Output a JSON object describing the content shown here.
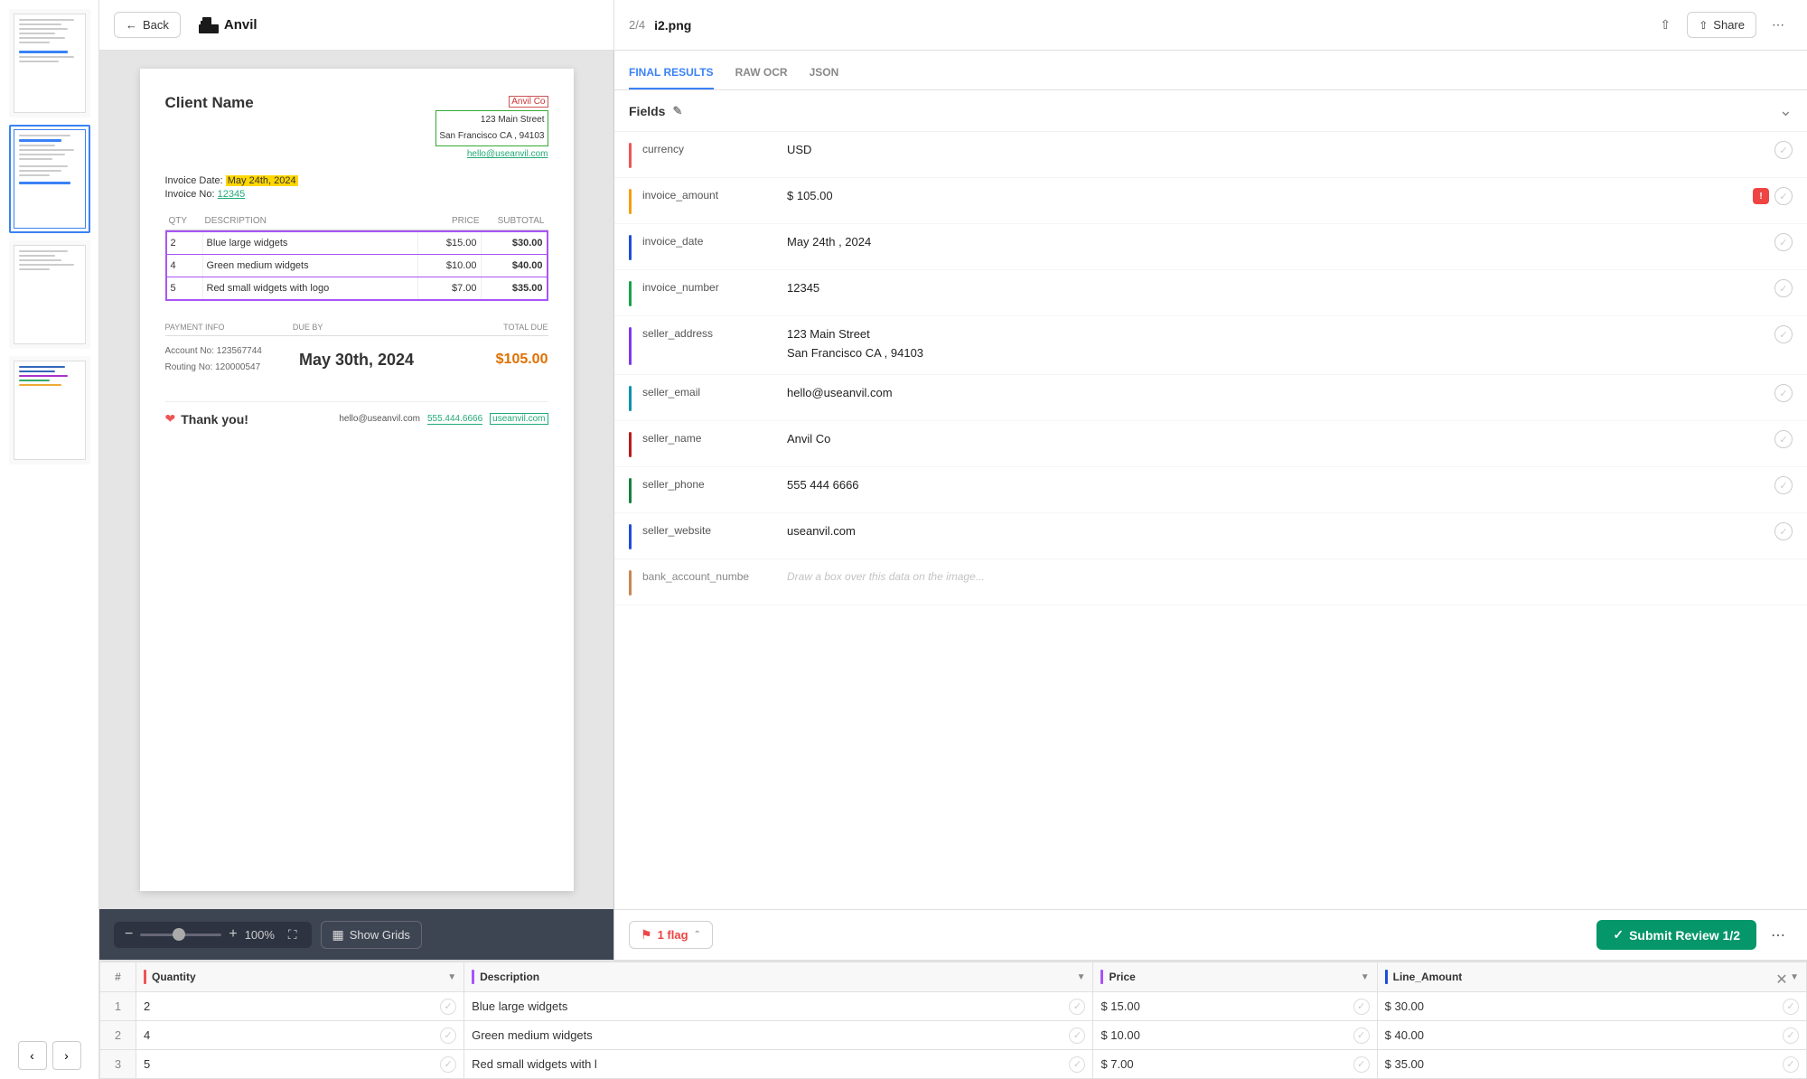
{
  "app": {
    "back_label": "Back",
    "logo_text": "Anvil"
  },
  "header": {
    "page_info": "2/4",
    "file_name": "i2.png",
    "share_label": "Share"
  },
  "tabs": [
    {
      "id": "final_results",
      "label": "FINAL RESULTS",
      "active": true
    },
    {
      "id": "raw_ocr",
      "label": "RAW OCR",
      "active": false
    },
    {
      "id": "json",
      "label": "JSON",
      "active": false
    }
  ],
  "fields_section": {
    "title": "Fields",
    "fields": [
      {
        "id": "currency",
        "label": "currency",
        "value": "USD",
        "color": "#e55",
        "has_flag": false,
        "checked": false
      },
      {
        "id": "invoice_amount",
        "label": "invoice_amount",
        "value": "$ 105.00",
        "color": "#f59e0b",
        "has_flag": true,
        "checked": false
      },
      {
        "id": "invoice_date",
        "label": "invoice_date",
        "value": "May 24th , 2024",
        "color": "#1d4ed8",
        "has_flag": false,
        "checked": false
      },
      {
        "id": "invoice_number",
        "label": "invoice_number",
        "value": "12345",
        "color": "#16a34a",
        "has_flag": false,
        "checked": false
      },
      {
        "id": "seller_address",
        "label": "seller_address",
        "value": "123 Main Street\nSan Francisco CA , 94103",
        "color": "#7c3aed",
        "has_flag": false,
        "checked": false
      },
      {
        "id": "seller_email",
        "label": "seller_email",
        "value": "hello@useanvil.com",
        "color": "#0891b2",
        "has_flag": false,
        "checked": false
      },
      {
        "id": "seller_name",
        "label": "seller_name",
        "value": "Anvil Co",
        "color": "#b91c1c",
        "has_flag": false,
        "checked": false
      },
      {
        "id": "seller_phone",
        "label": "seller_phone",
        "value": "555 444 6666",
        "color": "#15803d",
        "has_flag": false,
        "checked": false
      },
      {
        "id": "seller_website",
        "label": "seller_website",
        "value": "useanvil.com",
        "color": "#1d4ed8",
        "has_flag": false,
        "checked": false
      },
      {
        "id": "bank_account_number",
        "label": "bank_account_numbe",
        "value": "Draw a box over this data on the image...",
        "color": "#b45309",
        "has_flag": false,
        "checked": false,
        "ghost": true
      }
    ]
  },
  "invoice": {
    "client_name": "Client Name",
    "seller_name_tag": "Anvil Co",
    "seller_address_line1": "123 Main Street",
    "seller_address_line2": "San Francisco CA , 94103",
    "seller_email": "hello@useanvil.com",
    "invoice_date_label": "Invoice Date:",
    "invoice_date_value": "May 24th, 2024",
    "invoice_no_label": "Invoice No:",
    "invoice_no_value": "12345",
    "table": {
      "col_qty": "QTY",
      "col_desc": "DESCRIPTION",
      "col_price": "PRICE",
      "col_subtotal": "SUBTOTAL",
      "rows": [
        {
          "qty": "2",
          "desc": "Blue large widgets",
          "price": "$15.00",
          "subtotal": "$30.00"
        },
        {
          "qty": "4",
          "desc": "Green medium widgets",
          "price": "$10.00",
          "subtotal": "$40.00"
        },
        {
          "qty": "5",
          "desc": "Red small widgets with logo",
          "price": "$7.00",
          "subtotal": "$35.00"
        }
      ]
    },
    "payment_info_label": "PAYMENT INFO",
    "due_by_label": "DUE BY",
    "total_due_label": "TOTAL DUE",
    "account_no_label": "Account No:",
    "account_no_value": "123567744",
    "routing_no_label": "Routing No:",
    "routing_no_value": "120000547",
    "due_date": "May 30th, 2024",
    "total_due_value": "$105.00",
    "thank_you": "Thank you!",
    "footer_email": "hello@useanvil.com",
    "footer_phone": "555.444.6666",
    "footer_url": "useanvil.com"
  },
  "toolbar": {
    "zoom_pct": "100%",
    "show_grids_label": "Show Grids"
  },
  "bottom_table": {
    "columns": [
      {
        "id": "quantity",
        "label": "Quantity",
        "color": "#e55"
      },
      {
        "id": "description",
        "label": "Description",
        "color": "#a855f7"
      },
      {
        "id": "price",
        "label": "Price",
        "color": "#a855f7"
      },
      {
        "id": "line_amount",
        "label": "Line_Amount",
        "color": "#1d4ed8"
      }
    ],
    "rows": [
      {
        "row_num": 1,
        "quantity": "2",
        "description": "Blue large widgets",
        "price": "$ 15.00",
        "line_amount": "$ 30.00"
      },
      {
        "row_num": 2,
        "quantity": "4",
        "description": "Green medium widgets",
        "price": "$ 10.00",
        "line_amount": "$ 40.00"
      },
      {
        "row_num": 3,
        "quantity": "5",
        "description": "Red small widgets with l",
        "price": "$ 7.00",
        "line_amount": "$ 35.00"
      }
    ]
  },
  "action_bar": {
    "flag_count": "1 flag",
    "submit_label": "Submit Review 1/2"
  },
  "sidebar_thumbs": [
    {
      "id": 1,
      "active": false
    },
    {
      "id": 2,
      "active": true
    },
    {
      "id": 3,
      "active": false
    },
    {
      "id": 4,
      "active": false
    }
  ]
}
